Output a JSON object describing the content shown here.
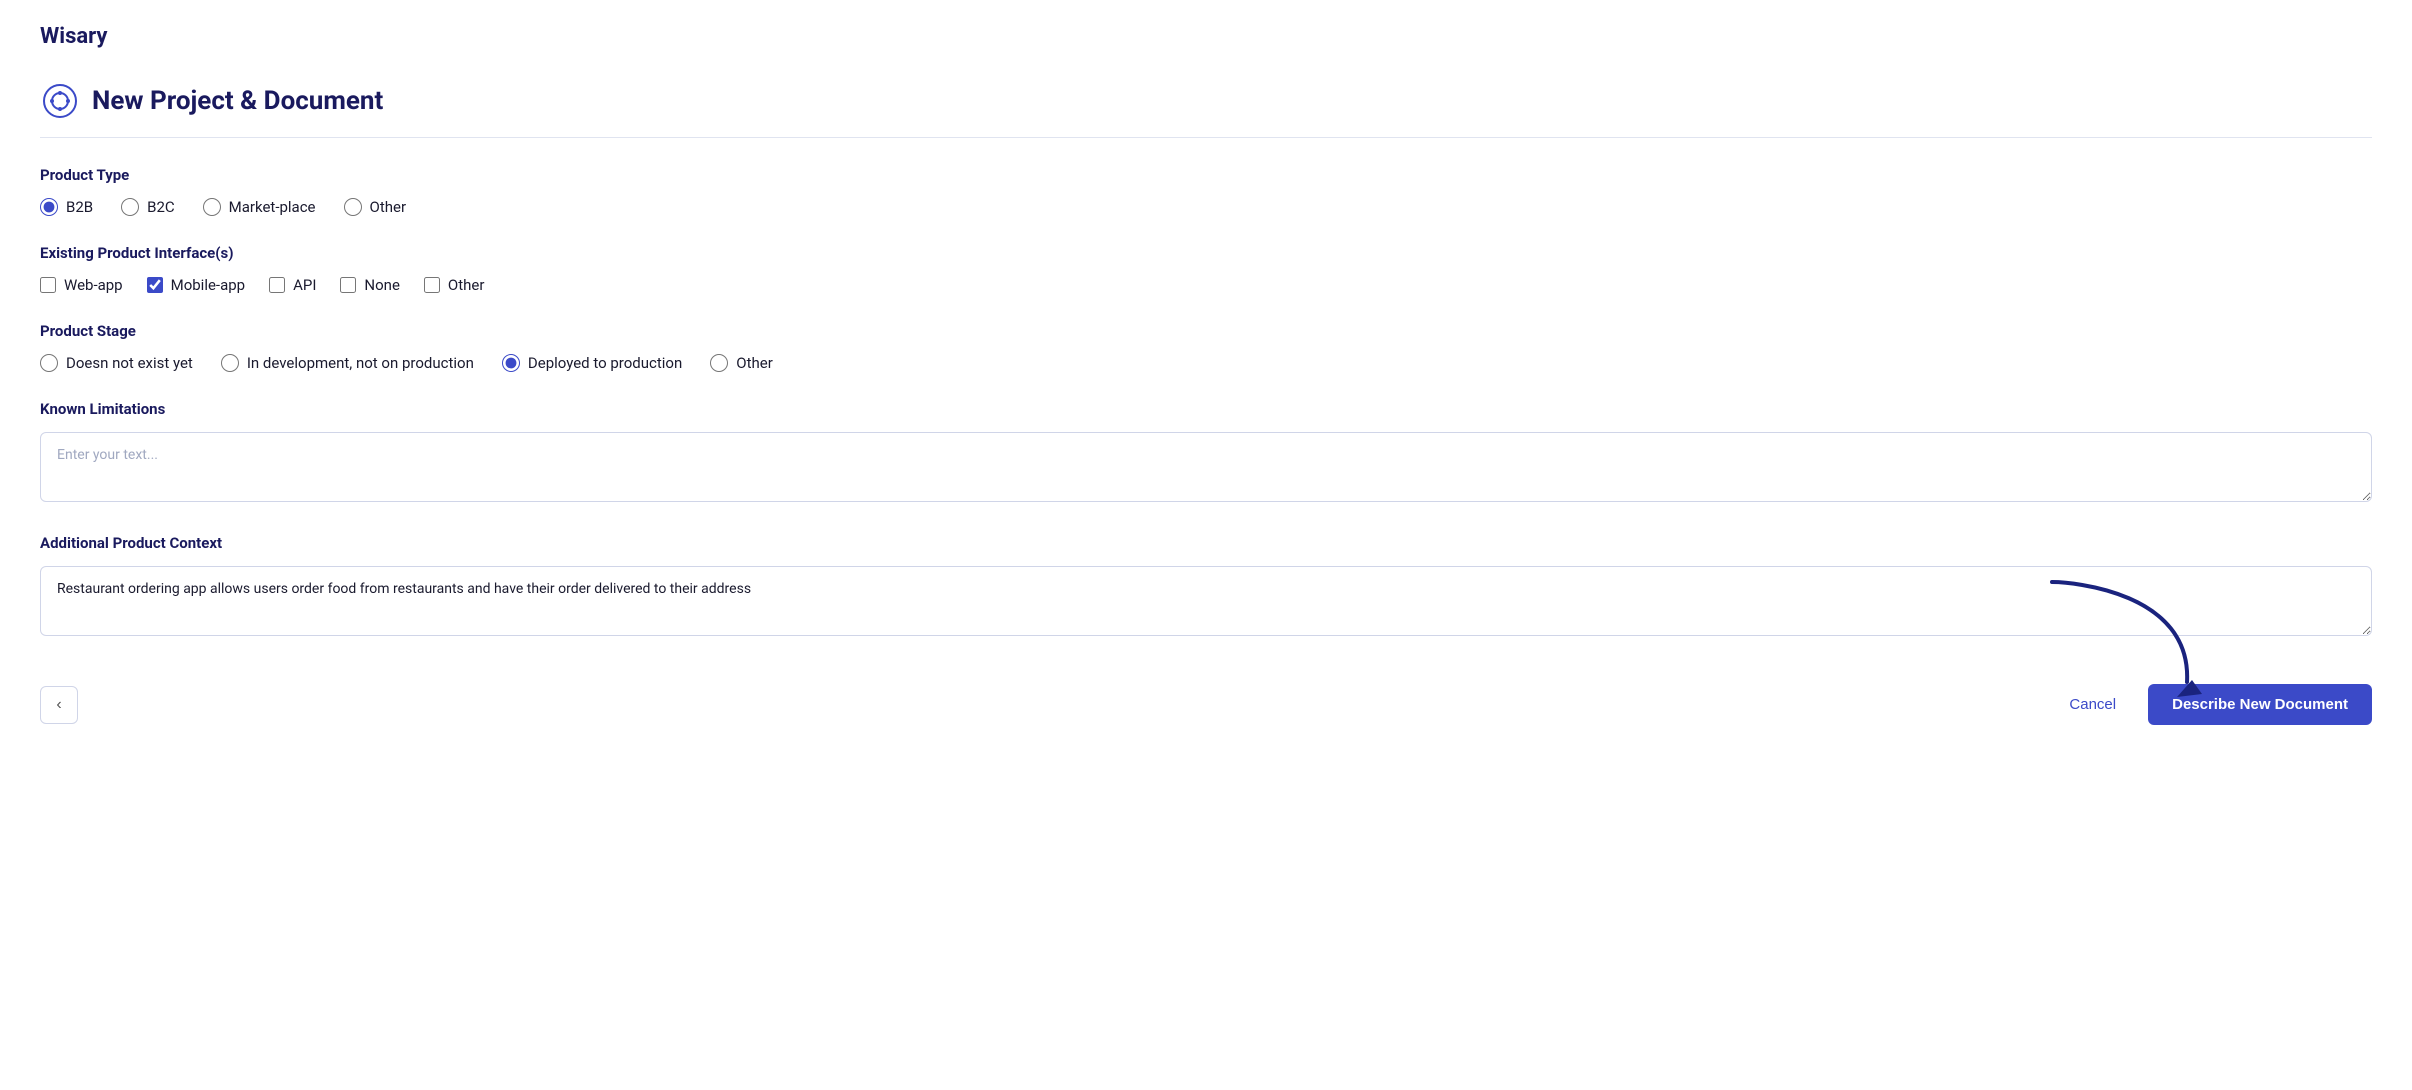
{
  "app": {
    "title": "Wisary"
  },
  "page": {
    "title": "New Project & Document",
    "icon": "⚙️"
  },
  "productType": {
    "label": "Product Type",
    "options": [
      "B2B",
      "B2C",
      "Market-place",
      "Other"
    ],
    "selected": "B2B"
  },
  "existingInterfaces": {
    "label": "Existing Product Interface(s)",
    "options": [
      "Web-app",
      "Mobile-app",
      "API",
      "None",
      "Other"
    ],
    "checked": [
      "Mobile-app"
    ]
  },
  "productStage": {
    "label": "Product Stage",
    "options": [
      "Doesn not exist yet",
      "In development, not on production",
      "Deployed to production",
      "Other"
    ],
    "selected": "Deployed to production"
  },
  "knownLimitations": {
    "label": "Known Limitations",
    "placeholder": "Enter your text...",
    "value": ""
  },
  "additionalContext": {
    "label": "Additional Product Context",
    "placeholder": "Enter your text...",
    "value": "Restaurant ordering app allows users order food from restaurants and have their order delivered to their address"
  },
  "footer": {
    "backLabel": "<",
    "cancelLabel": "Cancel",
    "describeLabel": "Describe New Document"
  }
}
